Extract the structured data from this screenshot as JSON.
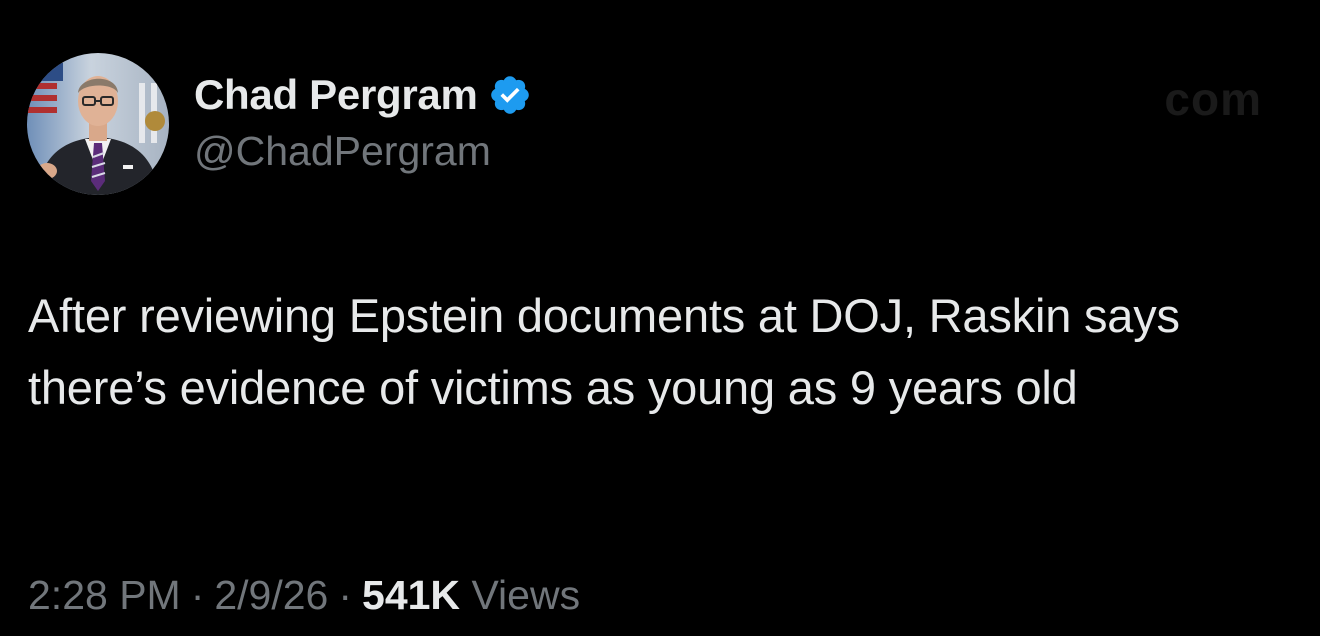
{
  "author": {
    "display_name": "Chad Pergram",
    "handle": "@ChadPergram",
    "verified": true,
    "verified_icon": "verified-badge-icon",
    "verified_color": "#1d9bf0"
  },
  "watermark": "com",
  "tweet": {
    "text": "After reviewing Epstein documents at DOJ, Raskin says there’s evidence of victims as young as 9 years old"
  },
  "meta": {
    "time": "2:28 PM",
    "separator": "·",
    "date": "2/9/26",
    "views_count": "541K",
    "views_label": "Views"
  },
  "colors": {
    "background": "#000000",
    "primary_text": "#e7e9ea",
    "secondary_text": "#71767b"
  }
}
